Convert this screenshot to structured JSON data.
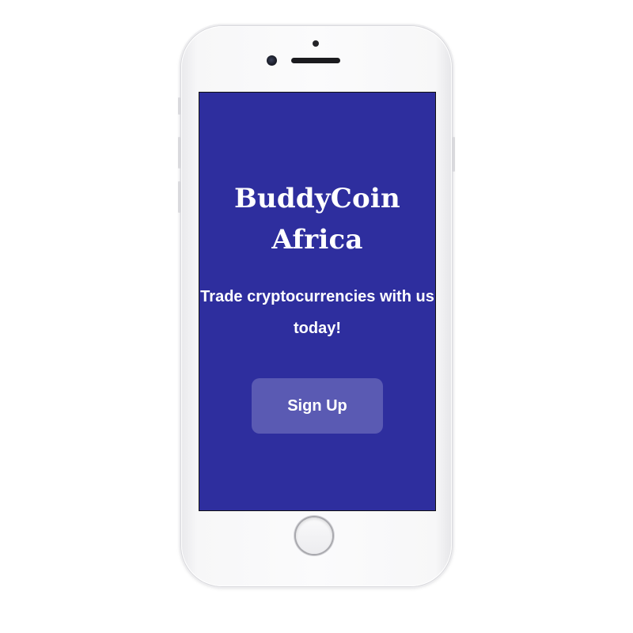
{
  "app": {
    "title": "BuddyCoin Africa",
    "tagline": "Trade cryptocurrencies with us today!",
    "signup_label": "Sign Up"
  },
  "colors": {
    "background": "#2e2e9e",
    "button": "#5a5ab3",
    "text": "#ffffff"
  },
  "icons": {
    "home": "home-button-icon"
  }
}
